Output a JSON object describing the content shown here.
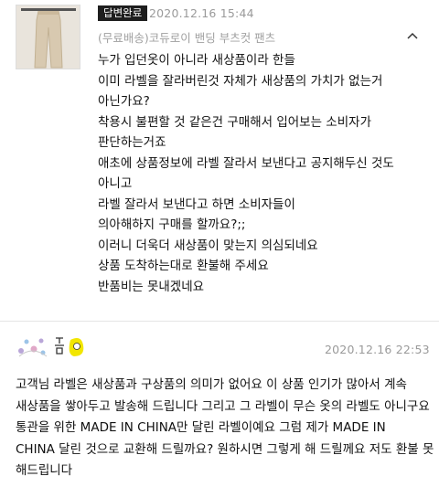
{
  "review": {
    "status_badge": "답변완료",
    "date": "2020.12.16 15:44",
    "product_name": "(무료배송)코듀로이 밴딩 부츠컷 팬츠",
    "lines": [
      "누가 입던옷이 아니라 새상품이라 한들",
      "이미 라벨을 잘라버린것 자체가 새상품의 가치가 없는거",
      "아닌가요?",
      "착용시 불편할 것 같은건 구매해서 입어보는 소비자가",
      "판단하는거죠",
      "애초에 상품정보에 라벨 잘라서 보낸다고 공지해두신 것도",
      "아니고",
      "라벨 잘라서 보낸다고 하면 소비자들이",
      "의아해하지 구매를 할까요?;;",
      "이러니 더욱더 새상품이 맞는지 의심되네요",
      "상품 도착하는대로 환불해 주세요",
      "반품비는 못내겠네요"
    ]
  },
  "answer": {
    "date": "2020.12.16 22:53",
    "lines": [
      "고객님 라벨은 새상품과 구상품의 의미가 없어요 이 상품 인기가 많아서 계속",
      "새상품을 쌓아두고 발송해 드립니다 그리고 그 라벨이 무슨 옷의 라벨도 아니구요",
      "통관을 위한 MADE IN CHINA만 달린 라벨이예요 그럼 제가 MADE IN",
      "CHINA 달린 것으로 교환해 드릴까요? 원하시면 그렇게 해 드릴께요 저도 환불 못",
      "해드립니다"
    ]
  },
  "icons": {
    "thumbnail": "product-thumbnail",
    "collapse": "chevron-up-icon",
    "seller_logo": "seller-logo"
  },
  "colors": {
    "badge_bg": "#1e1e1e",
    "meta_text": "#9a9a9a",
    "body_text": "#111111"
  }
}
